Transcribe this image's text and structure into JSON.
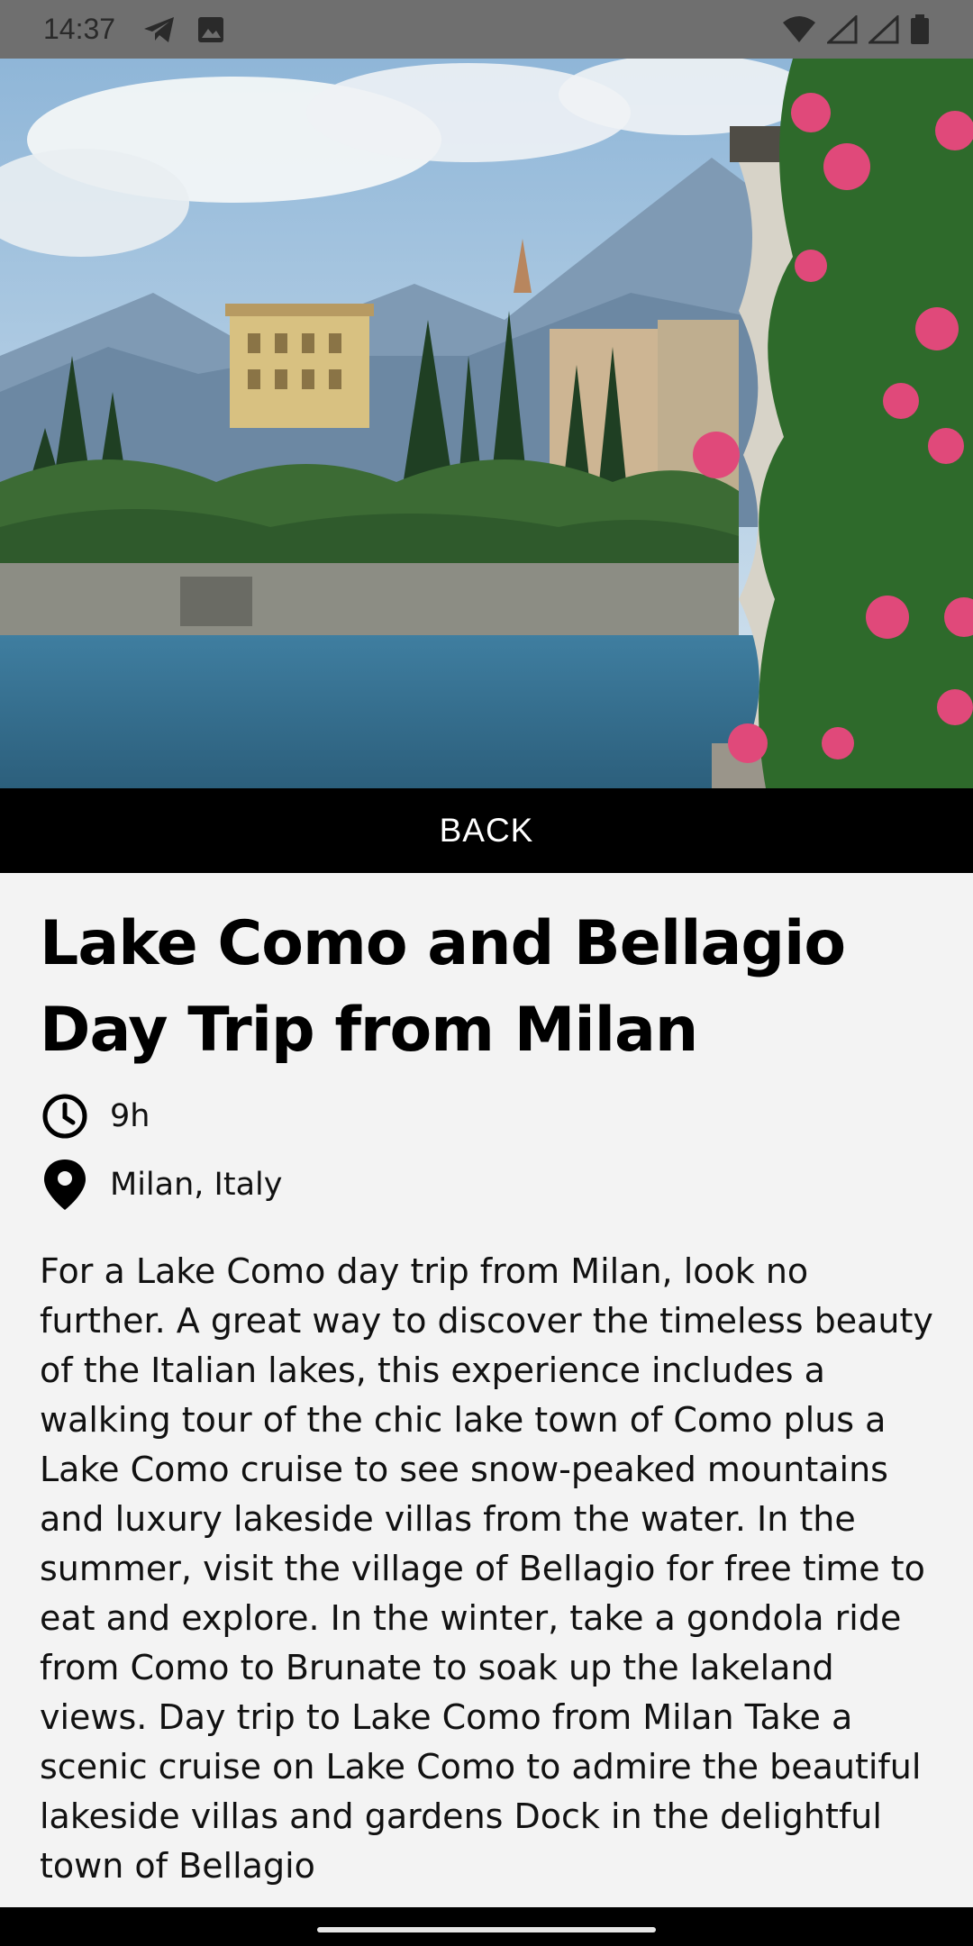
{
  "status_bar": {
    "time": "14:37",
    "left_icons": [
      "telegram-icon",
      "image-icon"
    ],
    "right_icons": [
      "wifi-icon",
      "signal-icon",
      "signal-icon",
      "battery-icon"
    ]
  },
  "hero": {
    "image": "lake-como-photo"
  },
  "back_button": {
    "label": "BACK"
  },
  "tour": {
    "title": "Lake Como and Bellagio Day Trip from Milan",
    "duration": "9h",
    "location": "Milan, Italy",
    "description": "For a Lake Como day trip from Milan, look no further. A great way to discover the timeless beauty of the Italian lakes, this experience includes a walking tour of the chic lake town of Como plus a Lake Como cruise to see snow-peaked mountains and luxury lakeside villas from the water. In the summer, visit the village of Bellagio for free time to eat and explore. In the winter, take a gondola ride from Como to Brunate to soak up the lakeland views. Day trip to Lake Como from Milan Take a scenic cruise on Lake Como to admire the beautiful lakeside villas and gardens Dock in the delightful town of Bellagio"
  },
  "colors": {
    "status_bar_bg": "#6f6f6f",
    "back_bar_bg": "#000000",
    "page_bg": "#f3f3f3"
  }
}
